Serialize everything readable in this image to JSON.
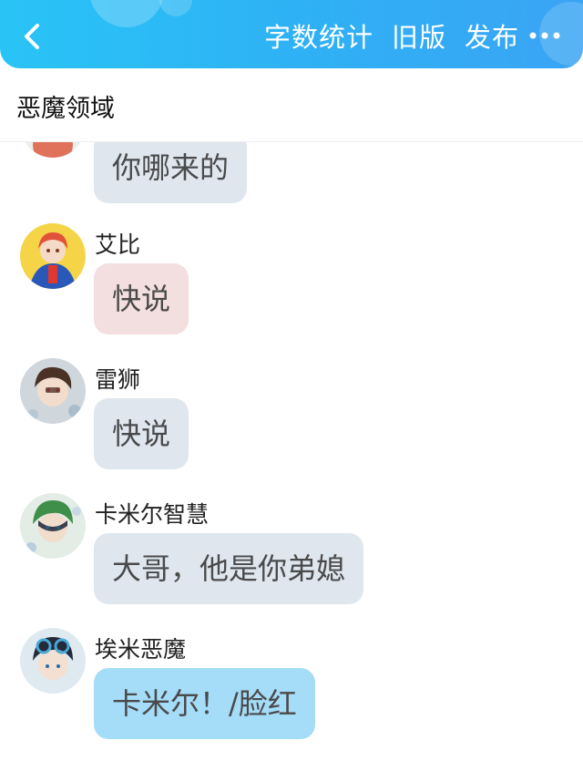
{
  "header": {
    "actions": [
      "字数统计",
      "旧版",
      "发布"
    ]
  },
  "doc": {
    "title": "恶魔领域"
  },
  "messages": [
    {
      "sender": "",
      "text": "你哪来的",
      "bubble_color": "#dfe6ee"
    },
    {
      "sender": "艾比",
      "text": "快说",
      "bubble_color": "#f4dfe0"
    },
    {
      "sender": "雷狮",
      "text": "快说",
      "bubble_color": "#dfe6ee"
    },
    {
      "sender": "卡米尔智慧",
      "text": "大哥，他是你弟媳",
      "bubble_color": "#dfe6ee"
    },
    {
      "sender": "埃米恶魔",
      "text": "卡米尔！/脸红",
      "bubble_color": "#a5dcf8"
    }
  ]
}
